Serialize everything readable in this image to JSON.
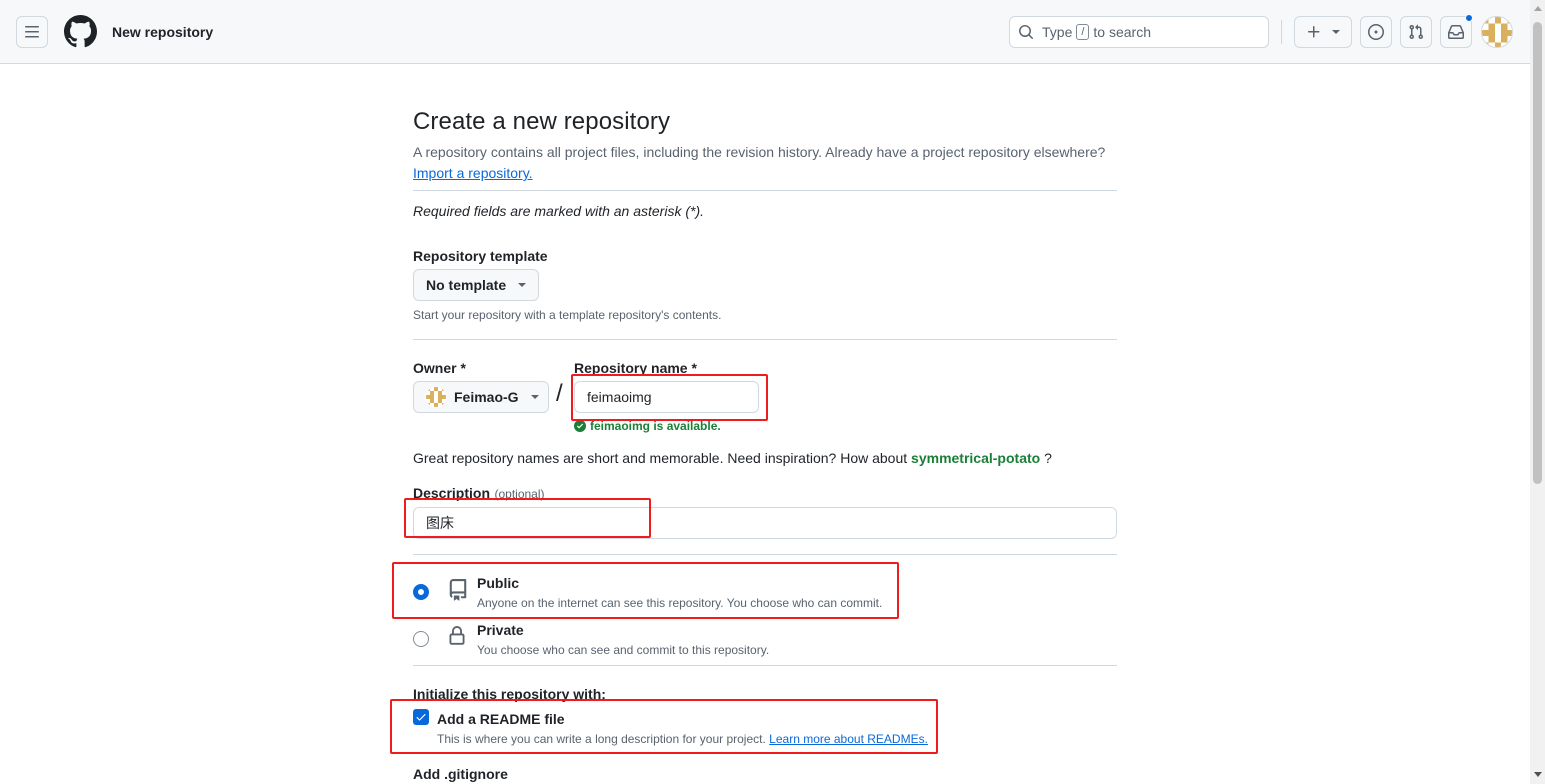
{
  "header": {
    "title": "New repository",
    "search": {
      "prefix": "Type",
      "key": "/",
      "suffix": "to search"
    }
  },
  "page": {
    "heading": "Create a new repository",
    "lead": "A repository contains all project files, including the revision history. Already have a project repository elsewhere?",
    "import_link": "Import a repository.",
    "required_note": "Required fields are marked with an asterisk (*)."
  },
  "template": {
    "label": "Repository template",
    "value": "No template",
    "note": "Start your repository with a template repository's contents."
  },
  "owner": {
    "label": "Owner *",
    "value": "Feimao-G"
  },
  "separator": "/",
  "repo_name": {
    "label": "Repository name *",
    "value": "feimaoimg",
    "availability": "feimaoimg is available."
  },
  "inspiration": {
    "text": "Great repository names are short and memorable. Need inspiration? How about",
    "suggestion": "symmetrical-potato",
    "end": "?"
  },
  "description": {
    "label": "Description",
    "optional": "(optional)",
    "value": "图床"
  },
  "visibility": {
    "public": {
      "label": "Public",
      "desc": "Anyone on the internet can see this repository. You choose who can commit."
    },
    "private": {
      "label": "Private",
      "desc": "You choose who can see and commit to this repository."
    }
  },
  "initialize": {
    "label": "Initialize this repository with:",
    "readme": {
      "label": "Add a README file",
      "desc": "This is where you can write a long description for your project.",
      "link": "Learn more about READMEs."
    },
    "gitignore_label": "Add .gitignore"
  },
  "colors": {
    "accent": "#0969da",
    "success": "#1a7f37",
    "annotation": "#ee1c1c"
  }
}
